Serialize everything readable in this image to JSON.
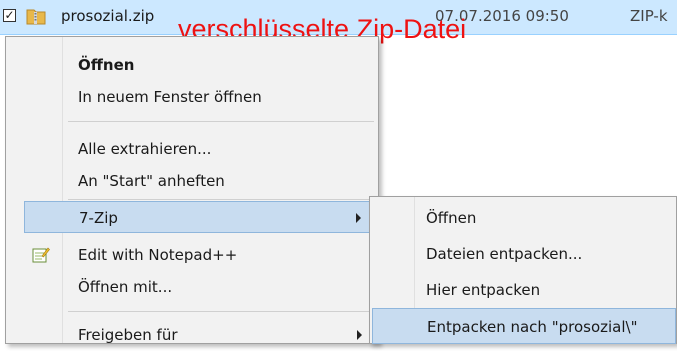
{
  "file": {
    "name": "prosozial.zip",
    "date": "07.07.2016 09:50",
    "type": "ZIP-k"
  },
  "annotation": "verschlüsselte Zip-Datei",
  "context_menu": {
    "items": [
      {
        "label": "Öffnen"
      },
      {
        "label": "In neuem Fenster öffnen"
      },
      {
        "label": "Alle extrahieren..."
      },
      {
        "label": "An \"Start\" anheften"
      },
      {
        "label": "7-Zip"
      },
      {
        "label": "Edit with Notepad++",
        "icon": "notepad-plus-plus-icon"
      },
      {
        "label": "Öffnen mit..."
      },
      {
        "label": "Freigeben für"
      }
    ]
  },
  "submenu_7zip": {
    "items": [
      {
        "label": "Öffnen"
      },
      {
        "label": "Dateien entpacken..."
      },
      {
        "label": "Hier entpacken"
      },
      {
        "label": "Entpacken nach \"prosozial\\\""
      }
    ]
  },
  "colors": {
    "selection": "#cce8ff",
    "menu_bg": "#f2f2f2",
    "hover": "#c8dcf0",
    "annotation": "#ee1212"
  }
}
